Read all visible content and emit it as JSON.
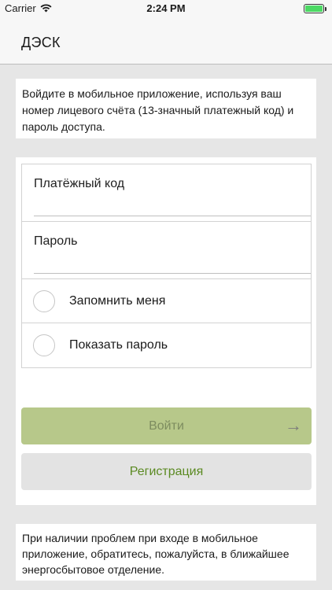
{
  "status_bar": {
    "carrier": "Carrier",
    "time": "2:24 PM",
    "battery_level": 1.0,
    "wifi_icon": "wifi-icon",
    "battery_icon": "battery-icon"
  },
  "navbar": {
    "title": "ДЭСК"
  },
  "info": {
    "text": "Войдите в мобильное приложение, используя ваш номер лицевого счёта (13-значный платежный код) и пароль доступа."
  },
  "form": {
    "payment_code_label": "Платёжный код",
    "payment_code_value": "",
    "password_label": "Пароль",
    "password_value": "",
    "remember_label": "Запомнить меня",
    "show_password_label": "Показать пароль",
    "login_label": "Войти",
    "login_icon": "arrow-right-icon",
    "register_label": "Регистрация"
  },
  "help": {
    "text": "При наличии проблем при входе в мобильное приложение, обратитесь, пожалуйста, в ближайшее энергосбытовое отделение."
  },
  "colors": {
    "login_button": "#b7c88a",
    "register_text": "#5b8a22",
    "battery": "#4cd964"
  }
}
